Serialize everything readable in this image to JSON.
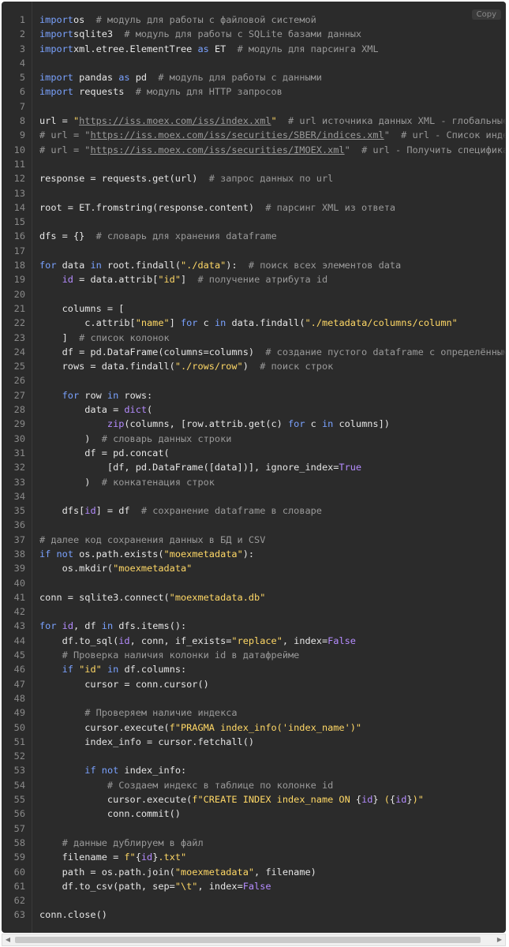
{
  "copy_label": "Copy",
  "lines": [
    {
      "n": "1",
      "t": [
        [
          "kw",
          "import"
        ],
        [
          "",
          "os"
        ],
        [
          "",
          "  "
        ],
        [
          "cm",
          "# модуль для работы с файловой системой"
        ]
      ]
    },
    {
      "n": "2",
      "t": [
        [
          "kw",
          "import"
        ],
        [
          "",
          "sqlite3"
        ],
        [
          "",
          "  "
        ],
        [
          "cm",
          "# модуль для работы с SQLite базами данных"
        ]
      ]
    },
    {
      "n": "3",
      "t": [
        [
          "kw",
          "import"
        ],
        [
          "",
          "xml.etree.ElementTree "
        ],
        [
          "kw",
          "as"
        ],
        [
          "",
          " ET  "
        ],
        [
          "cm",
          "# модуль для парсинга XML"
        ]
      ]
    },
    {
      "n": "4",
      "t": []
    },
    {
      "n": "5",
      "t": [
        [
          "kw",
          "import"
        ],
        [
          "",
          " pandas "
        ],
        [
          "kw",
          "as"
        ],
        [
          "",
          " pd  "
        ],
        [
          "cm",
          "# модуль для работы с данными"
        ]
      ]
    },
    {
      "n": "6",
      "t": [
        [
          "kw",
          "import"
        ],
        [
          "",
          " requests  "
        ],
        [
          "cm",
          "# модуль для HTTP запросов"
        ]
      ]
    },
    {
      "n": "7",
      "t": []
    },
    {
      "n": "8",
      "t": [
        [
          "",
          "url = "
        ],
        [
          "st",
          "\""
        ],
        [
          "url",
          "https://iss.moex.com/iss/index.xml"
        ],
        [
          "st",
          "\""
        ],
        [
          "",
          "  "
        ],
        [
          "cm",
          "# url источника данных XML - глобальные спра"
        ]
      ]
    },
    {
      "n": "9",
      "t": [
        [
          "cm",
          "# url = \""
        ],
        [
          "url",
          "https://iss.moex.com/iss/securities/SBER/indices.xml"
        ],
        [
          "cm",
          "\"  # url - Список индексов"
        ]
      ]
    },
    {
      "n": "10",
      "t": [
        [
          "cm",
          "# url = \""
        ],
        [
          "url",
          "https://iss.moex.com/iss/securities/IMOEX.xml"
        ],
        [
          "cm",
          "\"  # url - Получить спецификацию и"
        ]
      ]
    },
    {
      "n": "11",
      "t": []
    },
    {
      "n": "12",
      "t": [
        [
          "",
          "response = requests.get(url)  "
        ],
        [
          "cm",
          "# запрос данных по url"
        ]
      ]
    },
    {
      "n": "13",
      "t": []
    },
    {
      "n": "14",
      "t": [
        [
          "",
          "root = ET.fromstring(response.content)  "
        ],
        [
          "cm",
          "# парсинг XML из ответа"
        ]
      ]
    },
    {
      "n": "15",
      "t": []
    },
    {
      "n": "16",
      "t": [
        [
          "",
          "dfs = {}  "
        ],
        [
          "cm",
          "# словарь для хранения dataframe"
        ]
      ]
    },
    {
      "n": "17",
      "t": []
    },
    {
      "n": "18",
      "t": [
        [
          "kw",
          "for"
        ],
        [
          "",
          " data "
        ],
        [
          "kw",
          "in"
        ],
        [
          "",
          " root.findall("
        ],
        [
          "st",
          "\"./data\""
        ],
        [
          "",
          "):  "
        ],
        [
          "cm",
          "# поиск всех элементов data"
        ]
      ]
    },
    {
      "n": "19",
      "t": [
        [
          "",
          "    "
        ],
        [
          "bi",
          "id"
        ],
        [
          "",
          " = data.attrib["
        ],
        [
          "st",
          "\"id\""
        ],
        [
          "",
          "]  "
        ],
        [
          "cm",
          "# получение атрибута id"
        ]
      ]
    },
    {
      "n": "20",
      "t": []
    },
    {
      "n": "21",
      "t": [
        [
          "",
          "    columns = ["
        ]
      ]
    },
    {
      "n": "22",
      "t": [
        [
          "",
          "        c.attrib["
        ],
        [
          "st",
          "\"name\""
        ],
        [
          "",
          "] "
        ],
        [
          "kw",
          "for"
        ],
        [
          "",
          " c "
        ],
        [
          "kw",
          "in"
        ],
        [
          "",
          " data.findall("
        ],
        [
          "st",
          "\"./metadata/columns/column\""
        ],
        [
          ")"
        ]
      ]
    },
    {
      "n": "23",
      "t": [
        [
          "",
          "    ]  "
        ],
        [
          "cm",
          "# список колонок"
        ]
      ]
    },
    {
      "n": "24",
      "t": [
        [
          "",
          "    df = pd.DataFrame(columns=columns)  "
        ],
        [
          "cm",
          "# создание пустого dataframe с определёнными кол"
        ]
      ]
    },
    {
      "n": "25",
      "t": [
        [
          "",
          "    rows = data.findall("
        ],
        [
          "st",
          "\"./rows/row\""
        ],
        [
          "",
          ")  "
        ],
        [
          "cm",
          "# поиск строк"
        ]
      ]
    },
    {
      "n": "26",
      "t": []
    },
    {
      "n": "27",
      "t": [
        [
          "",
          "    "
        ],
        [
          "kw",
          "for"
        ],
        [
          "",
          " row "
        ],
        [
          "kw",
          "in"
        ],
        [
          "",
          " rows:"
        ]
      ]
    },
    {
      "n": "28",
      "t": [
        [
          "",
          "        data = "
        ],
        [
          "bi",
          "dict"
        ],
        [
          "",
          "("
        ]
      ]
    },
    {
      "n": "29",
      "t": [
        [
          "",
          "            "
        ],
        [
          "bi",
          "zip"
        ],
        [
          "",
          "(columns, [row.attrib.get(c) "
        ],
        [
          "kw",
          "for"
        ],
        [
          "",
          " c "
        ],
        [
          "kw",
          "in"
        ],
        [
          "",
          " columns])"
        ]
      ]
    },
    {
      "n": "30",
      "t": [
        [
          "",
          "        )  "
        ],
        [
          "cm",
          "# словарь данных строки"
        ]
      ]
    },
    {
      "n": "31",
      "t": [
        [
          "",
          "        df = pd.concat("
        ]
      ]
    },
    {
      "n": "32",
      "t": [
        [
          "",
          "            [df, pd.DataFrame([data])], ignore_index="
        ],
        [
          "bi",
          "True"
        ]
      ]
    },
    {
      "n": "33",
      "t": [
        [
          "",
          "        )  "
        ],
        [
          "cm",
          "# конкатенация строк"
        ]
      ]
    },
    {
      "n": "34",
      "t": []
    },
    {
      "n": "35",
      "t": [
        [
          "",
          "    dfs["
        ],
        [
          "bi",
          "id"
        ],
        [
          "",
          "] = df  "
        ],
        [
          "cm",
          "# сохранение dataframe в словаре"
        ]
      ]
    },
    {
      "n": "36",
      "t": []
    },
    {
      "n": "37",
      "t": [
        [
          "cm",
          "# далее код сохранения данных в БД и CSV"
        ]
      ]
    },
    {
      "n": "38",
      "t": [
        [
          "kw",
          "if"
        ],
        [
          "",
          " "
        ],
        [
          "kw",
          "not"
        ],
        [
          "",
          " os.path.exists("
        ],
        [
          "st",
          "\"moexmetadata\""
        ],
        [
          "",
          "):"
        ]
      ]
    },
    {
      "n": "39",
      "t": [
        [
          "",
          "    os.mkdir("
        ],
        [
          "st",
          "\"moexmetadata\""
        ],
        [
          ")"
        ]
      ]
    },
    {
      "n": "40",
      "t": []
    },
    {
      "n": "41",
      "t": [
        [
          "",
          "conn = sqlite3.connect("
        ],
        [
          "st",
          "\"moexmetadata.db\""
        ],
        [
          ")"
        ]
      ]
    },
    {
      "n": "42",
      "t": []
    },
    {
      "n": "43",
      "t": [
        [
          "kw",
          "for"
        ],
        [
          "",
          " "
        ],
        [
          "bi",
          "id"
        ],
        [
          "",
          ", df "
        ],
        [
          "kw",
          "in"
        ],
        [
          "",
          " dfs.items():"
        ]
      ]
    },
    {
      "n": "44",
      "t": [
        [
          "",
          "    df.to_sql("
        ],
        [
          "bi",
          "id"
        ],
        [
          "",
          ", conn, if_exists="
        ],
        [
          "st",
          "\"replace\""
        ],
        [
          "",
          ", index="
        ],
        [
          "bi",
          "False"
        ],
        [
          ")"
        ]
      ]
    },
    {
      "n": "45",
      "t": [
        [
          "",
          "    "
        ],
        [
          "cm",
          "# Проверка наличия колонки id в датафрейме"
        ]
      ]
    },
    {
      "n": "46",
      "t": [
        [
          "",
          "    "
        ],
        [
          "kw",
          "if"
        ],
        [
          "",
          " "
        ],
        [
          "st",
          "\"id\""
        ],
        [
          "",
          " "
        ],
        [
          "kw",
          "in"
        ],
        [
          "",
          " df.columns:"
        ]
      ]
    },
    {
      "n": "47",
      "t": [
        [
          "",
          "        cursor = conn.cursor()"
        ]
      ]
    },
    {
      "n": "48",
      "t": []
    },
    {
      "n": "49",
      "t": [
        [
          "",
          "        "
        ],
        [
          "cm",
          "# Проверяем наличие индекса"
        ]
      ]
    },
    {
      "n": "50",
      "t": [
        [
          "",
          "        cursor.execute("
        ],
        [
          "st",
          "f\"PRAGMA index_info('index_name')\""
        ],
        [
          ")"
        ]
      ]
    },
    {
      "n": "51",
      "t": [
        [
          "",
          "        index_info = cursor.fetchall()"
        ]
      ]
    },
    {
      "n": "52",
      "t": []
    },
    {
      "n": "53",
      "t": [
        [
          "",
          "        "
        ],
        [
          "kw",
          "if"
        ],
        [
          "",
          " "
        ],
        [
          "kw",
          "not"
        ],
        [
          "",
          " index_info:"
        ]
      ]
    },
    {
      "n": "54",
      "t": [
        [
          "",
          "            "
        ],
        [
          "cm",
          "# Создаем индекс в таблице по колонке id"
        ]
      ]
    },
    {
      "n": "55",
      "t": [
        [
          "",
          "            cursor.execute("
        ],
        [
          "st",
          "f\"CREATE INDEX index_name ON "
        ],
        [
          "",
          "{"
        ],
        [
          "bi",
          "id"
        ],
        [
          "",
          "}"
        ],
        [
          "st",
          " ("
        ],
        [
          "",
          "{"
        ],
        [
          "bi",
          "id"
        ],
        [
          "",
          "}"
        ],
        [
          "st",
          ")\""
        ],
        [
          ")"
        ]
      ]
    },
    {
      "n": "56",
      "t": [
        [
          "",
          "            conn.commit()"
        ]
      ]
    },
    {
      "n": "57",
      "t": []
    },
    {
      "n": "58",
      "t": [
        [
          "",
          "    "
        ],
        [
          "cm",
          "# данные дублируем в файл"
        ]
      ]
    },
    {
      "n": "59",
      "t": [
        [
          "",
          "    filename = "
        ],
        [
          "st",
          "f\""
        ],
        [
          "",
          "{"
        ],
        [
          "bi",
          "id"
        ],
        [
          "",
          "}"
        ],
        [
          "st",
          ".txt\""
        ]
      ]
    },
    {
      "n": "60",
      "t": [
        [
          "",
          "    path = os.path.join("
        ],
        [
          "st",
          "\"moexmetadata\""
        ],
        [
          "",
          ", filename)"
        ]
      ]
    },
    {
      "n": "61",
      "t": [
        [
          "",
          "    df.to_csv(path, sep="
        ],
        [
          "st",
          "\"\\t\""
        ],
        [
          "",
          ", index="
        ],
        [
          "bi",
          "False"
        ],
        [
          ")"
        ]
      ]
    },
    {
      "n": "62",
      "t": []
    },
    {
      "n": "63",
      "t": [
        [
          "",
          "conn.close()"
        ]
      ]
    }
  ]
}
